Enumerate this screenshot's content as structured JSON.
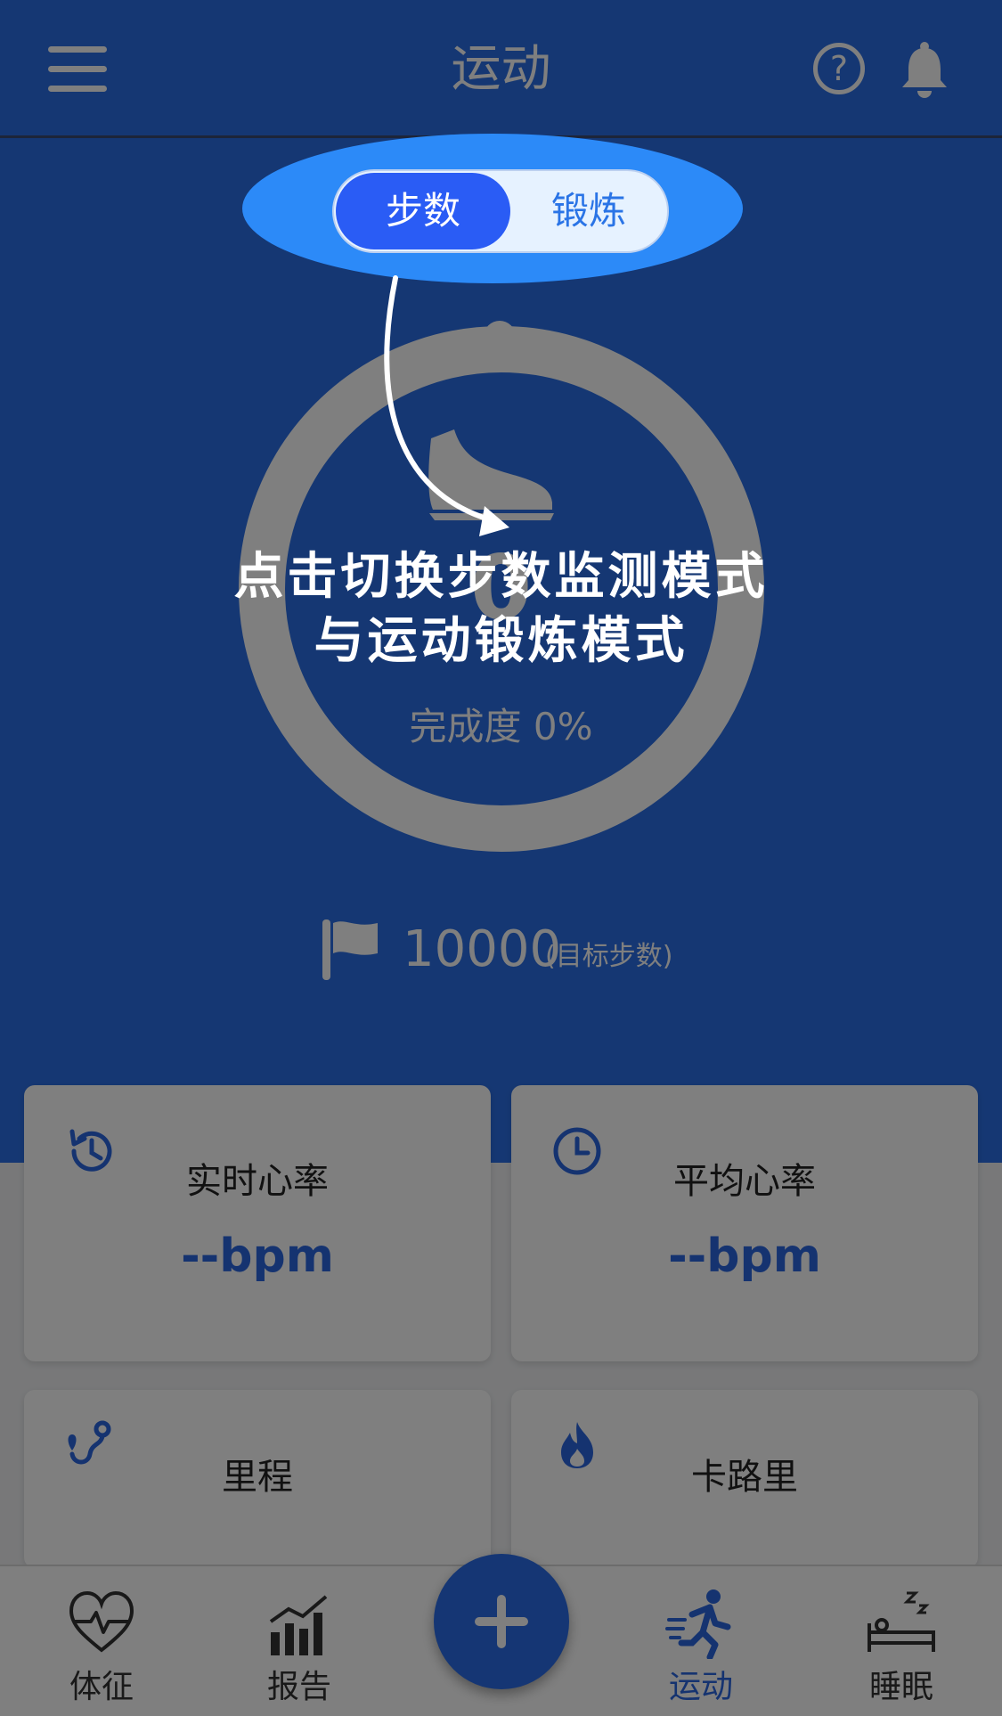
{
  "header": {
    "title": "运动",
    "help_icon": "question-circle-icon",
    "bell_icon": "bell-icon",
    "menu_icon": "hamburger-menu-icon"
  },
  "mode_toggle": {
    "selected": "步数",
    "step_label": "步数",
    "exercise_label": "锻炼"
  },
  "progress": {
    "value": "0",
    "completion_text": "完成度 0%",
    "completion_fraction": 0
  },
  "goal": {
    "value": "10000",
    "unit_label": "(目标步数)"
  },
  "cards": [
    {
      "icon": "history-clock-icon",
      "title": "实时心率",
      "value": "--bpm"
    },
    {
      "icon": "clock-icon",
      "title": "平均心率",
      "value": "--bpm"
    },
    {
      "icon": "route-icon",
      "title": "里程"
    },
    {
      "icon": "flame-icon",
      "title": "卡路里"
    }
  ],
  "bottom_nav": {
    "items": [
      {
        "label": "体征",
        "icon": "heart-pulse-icon",
        "active": false
      },
      {
        "label": "报告",
        "icon": "bar-chart-icon",
        "active": false
      },
      {
        "label": "运动",
        "icon": "running-icon",
        "active": true
      },
      {
        "label": "睡眠",
        "icon": "sleep-bed-icon",
        "active": false
      }
    ],
    "fab_icon": "plus-icon"
  },
  "overlay": {
    "line1": "点击切换步数监测模式",
    "line2": "与运动锻炼模式"
  },
  "colors": {
    "primary": "#2B6FE6",
    "active_nav": "#2A66E0",
    "toggle_active": "#2A5CF5",
    "spotlight": "#2C8AF8"
  }
}
